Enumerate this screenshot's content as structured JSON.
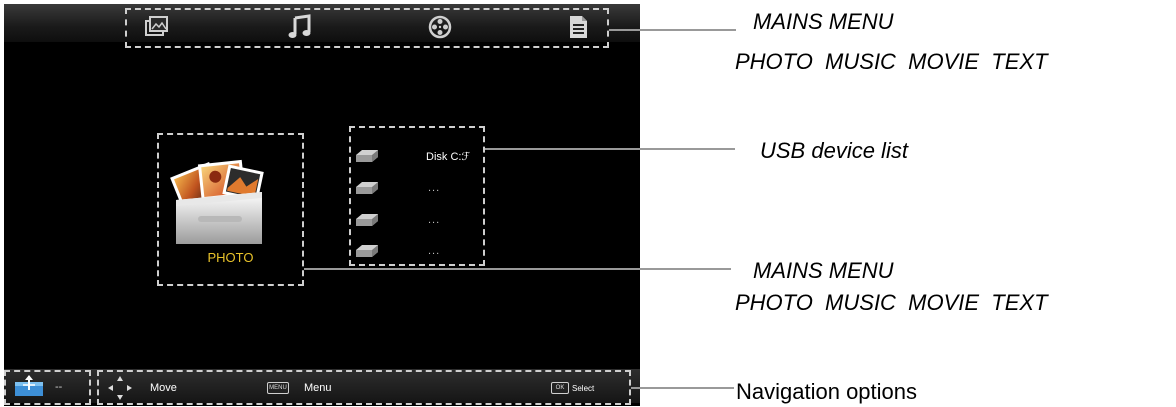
{
  "main_tabs": [
    {
      "icon": "photo-icon"
    },
    {
      "icon": "music-note-icon"
    },
    {
      "icon": "film-reel-icon"
    },
    {
      "icon": "text-document-icon"
    }
  ],
  "selected_media": {
    "label": "PHOTO",
    "icon": "photo-folder-icon",
    "label_color": "#e8c22a"
  },
  "usb_devices": [
    {
      "label": "Disk C:ℱ",
      "icon": "drive-icon"
    },
    {
      "label": "...",
      "icon": "drive-icon"
    },
    {
      "label": "...",
      "icon": "drive-icon"
    },
    {
      "label": "...",
      "icon": "drive-icon"
    }
  ],
  "nav": {
    "usb_status": "--",
    "move_label": "Move",
    "menu_key": "MENU",
    "menu_label": "Menu",
    "ok_key": "OK",
    "select_label": "Select"
  },
  "annotations": {
    "mains_menu_top": {
      "line1": "MAINS MENU",
      "line2": "PHOTO  MUSIC  MOVIE  TEXT"
    },
    "usb_list": "USB device list",
    "mains_menu_mid": {
      "line1": "MAINS MENU",
      "line2": "PHOTO  MUSIC  MOVIE  TEXT"
    },
    "navigation": "Navigation options"
  },
  "colors": {
    "screen_bg": "#000000",
    "accent_label": "#e8c22a",
    "dash": "#cfcfcf",
    "leader": "#999999"
  }
}
